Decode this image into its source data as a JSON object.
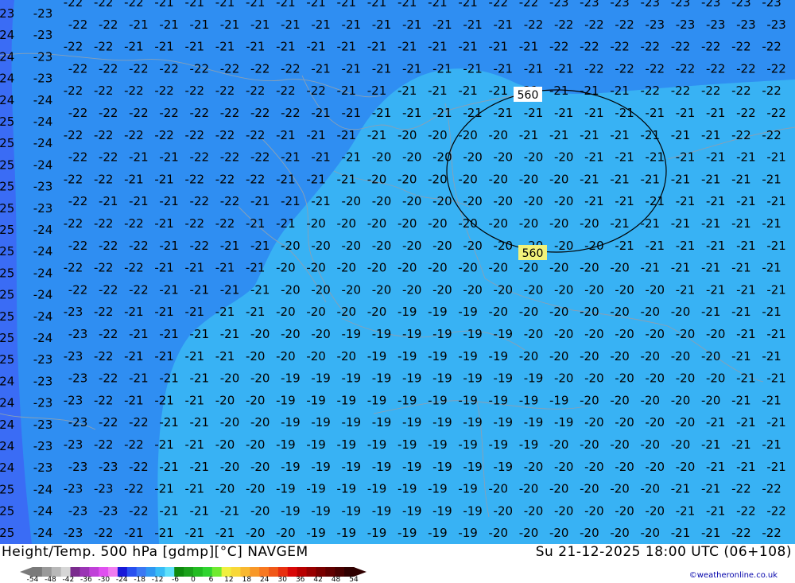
{
  "map": {
    "left_labels": [
      [
        "-23",
        "-23"
      ],
      [
        "-24",
        "-23"
      ],
      [
        "-24",
        "-23"
      ],
      [
        "-24",
        "-23"
      ],
      [
        "-24",
        "-24"
      ],
      [
        "-25",
        "-24"
      ],
      [
        "-25",
        "-24"
      ],
      [
        "-25",
        "-24"
      ],
      [
        "-25",
        "-23"
      ],
      [
        "-25",
        "-23"
      ],
      [
        "-25",
        "-24"
      ],
      [
        "-25",
        "-24"
      ],
      [
        "-25",
        "-24"
      ],
      [
        "-25",
        "-24"
      ],
      [
        "-25",
        "-24"
      ],
      [
        "-25",
        "-24"
      ],
      [
        "-25",
        "-23"
      ],
      [
        "-24",
        "-23"
      ],
      [
        "-24",
        "-23"
      ],
      [
        "-24",
        "-23"
      ],
      [
        "-24",
        "-23"
      ],
      [
        "-24",
        "-23"
      ],
      [
        "-25",
        "-24"
      ],
      [
        "-25",
        "-24"
      ],
      [
        "-25",
        "-24"
      ]
    ],
    "contour_labels": [
      "560",
      "560"
    ],
    "grid_rows": [
      [
        "-22",
        "-22",
        "-22",
        "-21",
        "-21",
        "-21",
        "-21",
        "-21",
        "-21",
        "-21",
        "-21",
        "-21",
        "-21",
        "-21",
        "-22",
        "-22",
        "-23",
        "-23",
        "-23",
        "-23",
        "-23",
        "-23",
        "-23",
        "-23"
      ],
      [
        "-22",
        "-22",
        "-21",
        "-21",
        "-21",
        "-21",
        "-21",
        "-21",
        "-21",
        "-21",
        "-21",
        "-21",
        "-21",
        "-21",
        "-21",
        "-22",
        "-22",
        "-22",
        "-22",
        "-23",
        "-23",
        "-23",
        "-23",
        "-23"
      ],
      [
        "-22",
        "-22",
        "-21",
        "-21",
        "-21",
        "-21",
        "-21",
        "-21",
        "-21",
        "-21",
        "-21",
        "-21",
        "-21",
        "-21",
        "-21",
        "-21",
        "-22",
        "-22",
        "-22",
        "-22",
        "-22",
        "-22",
        "-22",
        "-22"
      ],
      [
        "-22",
        "-22",
        "-22",
        "-22",
        "-22",
        "-22",
        "-22",
        "-22",
        "-21",
        "-21",
        "-21",
        "-21",
        "-21",
        "-21",
        "-21",
        "-21",
        "-21",
        "-22",
        "-22",
        "-22",
        "-22",
        "-22",
        "-22",
        "-22"
      ],
      [
        "-22",
        "-22",
        "-22",
        "-22",
        "-22",
        "-22",
        "-22",
        "-22",
        "-22",
        "-21",
        "-21",
        "-21",
        "-21",
        "-21",
        "-21",
        "-21",
        "-21",
        "-21",
        "-21",
        "-22",
        "-22",
        "-22",
        "-22",
        "-22"
      ],
      [
        "-22",
        "-22",
        "-22",
        "-22",
        "-22",
        "-22",
        "-22",
        "-22",
        "-21",
        "-21",
        "-21",
        "-21",
        "-21",
        "-21",
        "-21",
        "-21",
        "-21",
        "-21",
        "-21",
        "-21",
        "-21",
        "-21",
        "-22",
        "-22"
      ],
      [
        "-22",
        "-22",
        "-22",
        "-22",
        "-22",
        "-22",
        "-22",
        "-21",
        "-21",
        "-21",
        "-21",
        "-20",
        "-20",
        "-20",
        "-20",
        "-21",
        "-21",
        "-21",
        "-21",
        "-21",
        "-21",
        "-21",
        "-22",
        "-22"
      ],
      [
        "-22",
        "-22",
        "-21",
        "-21",
        "-22",
        "-22",
        "-22",
        "-21",
        "-21",
        "-21",
        "-20",
        "-20",
        "-20",
        "-20",
        "-20",
        "-20",
        "-20",
        "-21",
        "-21",
        "-21",
        "-21",
        "-21",
        "-21",
        "-21"
      ],
      [
        "-22",
        "-22",
        "-21",
        "-21",
        "-22",
        "-22",
        "-22",
        "-21",
        "-21",
        "-21",
        "-20",
        "-20",
        "-20",
        "-20",
        "-20",
        "-20",
        "-20",
        "-21",
        "-21",
        "-21",
        "-21",
        "-21",
        "-21",
        "-21"
      ],
      [
        "-22",
        "-21",
        "-21",
        "-21",
        "-22",
        "-22",
        "-21",
        "-21",
        "-21",
        "-20",
        "-20",
        "-20",
        "-20",
        "-20",
        "-20",
        "-20",
        "-20",
        "-21",
        "-21",
        "-21",
        "-21",
        "-21",
        "-21",
        "-21"
      ],
      [
        "-22",
        "-22",
        "-22",
        "-21",
        "-22",
        "-22",
        "-21",
        "-21",
        "-20",
        "-20",
        "-20",
        "-20",
        "-20",
        "-20",
        "-20",
        "-20",
        "-20",
        "-20",
        "-21",
        "-21",
        "-21",
        "-21",
        "-21",
        "-21"
      ],
      [
        "-22",
        "-22",
        "-22",
        "-21",
        "-22",
        "-21",
        "-21",
        "-20",
        "-20",
        "-20",
        "-20",
        "-20",
        "-20",
        "-20",
        "-20",
        "-20",
        "-20",
        "-20",
        "-21",
        "-21",
        "-21",
        "-21",
        "-21",
        "-21"
      ],
      [
        "-22",
        "-22",
        "-22",
        "-21",
        "-21",
        "-21",
        "-21",
        "-20",
        "-20",
        "-20",
        "-20",
        "-20",
        "-20",
        "-20",
        "-20",
        "-20",
        "-20",
        "-20",
        "-20",
        "-21",
        "-21",
        "-21",
        "-21",
        "-21"
      ],
      [
        "-22",
        "-22",
        "-22",
        "-21",
        "-21",
        "-21",
        "-21",
        "-20",
        "-20",
        "-20",
        "-20",
        "-20",
        "-20",
        "-20",
        "-20",
        "-20",
        "-20",
        "-20",
        "-20",
        "-20",
        "-21",
        "-21",
        "-21",
        "-21"
      ],
      [
        "-23",
        "-22",
        "-21",
        "-21",
        "-21",
        "-21",
        "-21",
        "-20",
        "-20",
        "-20",
        "-20",
        "-19",
        "-19",
        "-19",
        "-20",
        "-20",
        "-20",
        "-20",
        "-20",
        "-20",
        "-20",
        "-21",
        "-21",
        "-21"
      ],
      [
        "-23",
        "-22",
        "-21",
        "-21",
        "-21",
        "-21",
        "-20",
        "-20",
        "-20",
        "-19",
        "-19",
        "-19",
        "-19",
        "-19",
        "-19",
        "-20",
        "-20",
        "-20",
        "-20",
        "-20",
        "-20",
        "-20",
        "-21",
        "-21"
      ],
      [
        "-23",
        "-22",
        "-21",
        "-21",
        "-21",
        "-21",
        "-20",
        "-20",
        "-20",
        "-20",
        "-19",
        "-19",
        "-19",
        "-19",
        "-19",
        "-20",
        "-20",
        "-20",
        "-20",
        "-20",
        "-20",
        "-20",
        "-21",
        "-21"
      ],
      [
        "-23",
        "-22",
        "-21",
        "-21",
        "-21",
        "-20",
        "-20",
        "-19",
        "-19",
        "-19",
        "-19",
        "-19",
        "-19",
        "-19",
        "-19",
        "-19",
        "-20",
        "-20",
        "-20",
        "-20",
        "-20",
        "-20",
        "-21",
        "-21"
      ],
      [
        "-23",
        "-22",
        "-21",
        "-21",
        "-21",
        "-20",
        "-20",
        "-19",
        "-19",
        "-19",
        "-19",
        "-19",
        "-19",
        "-19",
        "-19",
        "-19",
        "-19",
        "-20",
        "-20",
        "-20",
        "-20",
        "-20",
        "-21",
        "-21"
      ],
      [
        "-23",
        "-22",
        "-22",
        "-21",
        "-21",
        "-20",
        "-20",
        "-19",
        "-19",
        "-19",
        "-19",
        "-19",
        "-19",
        "-19",
        "-19",
        "-19",
        "-19",
        "-20",
        "-20",
        "-20",
        "-20",
        "-21",
        "-21",
        "-21"
      ],
      [
        "-23",
        "-22",
        "-22",
        "-21",
        "-21",
        "-20",
        "-20",
        "-19",
        "-19",
        "-19",
        "-19",
        "-19",
        "-19",
        "-19",
        "-19",
        "-19",
        "-20",
        "-20",
        "-20",
        "-20",
        "-20",
        "-21",
        "-21",
        "-21"
      ],
      [
        "-23",
        "-23",
        "-22",
        "-21",
        "-21",
        "-20",
        "-20",
        "-19",
        "-19",
        "-19",
        "-19",
        "-19",
        "-19",
        "-19",
        "-19",
        "-20",
        "-20",
        "-20",
        "-20",
        "-20",
        "-20",
        "-21",
        "-21",
        "-21"
      ],
      [
        "-23",
        "-23",
        "-22",
        "-21",
        "-21",
        "-20",
        "-20",
        "-19",
        "-19",
        "-19",
        "-19",
        "-19",
        "-19",
        "-19",
        "-20",
        "-20",
        "-20",
        "-20",
        "-20",
        "-20",
        "-21",
        "-21",
        "-22",
        "-22"
      ],
      [
        "-23",
        "-23",
        "-22",
        "-21",
        "-21",
        "-21",
        "-20",
        "-19",
        "-19",
        "-19",
        "-19",
        "-19",
        "-19",
        "-19",
        "-20",
        "-20",
        "-20",
        "-20",
        "-20",
        "-20",
        "-21",
        "-21",
        "-22",
        "-22"
      ],
      [
        "-23",
        "-22",
        "-21",
        "-21",
        "-21",
        "-21",
        "-20",
        "-20",
        "-19",
        "-19",
        "-19",
        "-19",
        "-19",
        "-19",
        "-20",
        "-20",
        "-20",
        "-20",
        "-20",
        "-20",
        "-21",
        "-21",
        "-22",
        "-22"
      ]
    ],
    "colors": {
      "band_lt_minus24": "#3a6cf5",
      "band_minus24_minus22": "#2f8ef2",
      "band_minus22_minus20": "#38b2f4",
      "band_gt_minus20": "#2ec4f8",
      "contour_line": "#000000",
      "border_line": "#8aa0b4",
      "label_text": "#000000",
      "contour_label_bg": "#ffffff",
      "contour_label_bg_2": "#f2f27a"
    }
  },
  "footer": {
    "title_left": "Height/Temp. 500 hPa [gdmp][°C] NAVGEM",
    "title_right": "Su 21-12-2025 18:00 UTC (06+108)",
    "credit": "©weatheronline.co.uk",
    "scale_ticks": [
      "-54",
      "-48",
      "-42",
      "-36",
      "-30",
      "-24",
      "-18",
      "-12",
      "-6",
      "0",
      "6",
      "12",
      "18",
      "24",
      "30",
      "36",
      "42",
      "48",
      "54"
    ],
    "scale_colors": [
      "#7a7a7a",
      "#999999",
      "#b8b8b8",
      "#d6d6d6",
      "#7b2c8e",
      "#9a34b4",
      "#c040d8",
      "#e050f0",
      "#f07cf0",
      "#1818d8",
      "#2850f0",
      "#3a78f4",
      "#2f98f2",
      "#38bcf6",
      "#5ee0fa",
      "#0e8a0e",
      "#1aa01a",
      "#22bc22",
      "#30d430",
      "#70ea30",
      "#f0f040",
      "#f8d838",
      "#f8b830",
      "#f89828",
      "#f87820",
      "#f05818",
      "#e83010",
      "#d80808",
      "#b80000",
      "#980000",
      "#7a0000",
      "#600000",
      "#480000",
      "#300000"
    ]
  }
}
